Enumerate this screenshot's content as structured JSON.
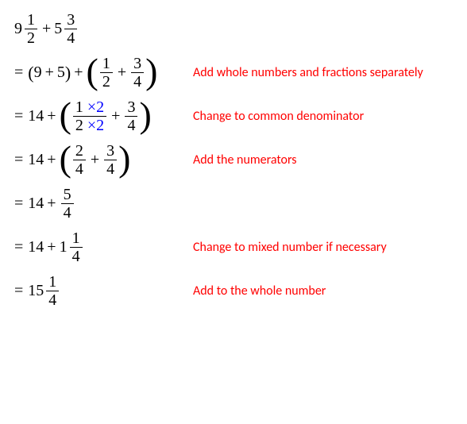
{
  "lines": {
    "l1": {
      "w1": "9",
      "n1": "1",
      "d1": "2",
      "op": "+",
      "w2": "5",
      "n2": "3",
      "d2": "4"
    },
    "l2": {
      "prefix": "=",
      "g1a": "9",
      "g1op": "+",
      "g1b": "5",
      "gop": "+",
      "n1": "1",
      "d1": "2",
      "fop": "+",
      "n2": "3",
      "d2": "4",
      "ann": "Add whole numbers and fractions separately"
    },
    "l3": {
      "prefix": "=",
      "whole": "14",
      "op": "+",
      "n1a": "1",
      "n1b": "×2",
      "d1a": "2",
      "d1b": "×2",
      "fop": "+",
      "n2": "3",
      "d2": "4",
      "ann": "Change to common denominator"
    },
    "l4": {
      "prefix": "=",
      "whole": "14",
      "op": "+",
      "n1": "2",
      "d1": "4",
      "fop": "+",
      "n2": "3",
      "d2": "4",
      "ann": "Add the numerators"
    },
    "l5": {
      "prefix": "=",
      "whole": "14",
      "op": "+",
      "n": "5",
      "d": "4"
    },
    "l6": {
      "prefix": "=",
      "whole": "14",
      "op": "+",
      "mw": "1",
      "n": "1",
      "d": "4",
      "ann": "Change to mixed number if necessary"
    },
    "l7": {
      "prefix": "=",
      "mw": "15",
      "n": "1",
      "d": "4",
      "ann": "Add to the whole number"
    }
  }
}
